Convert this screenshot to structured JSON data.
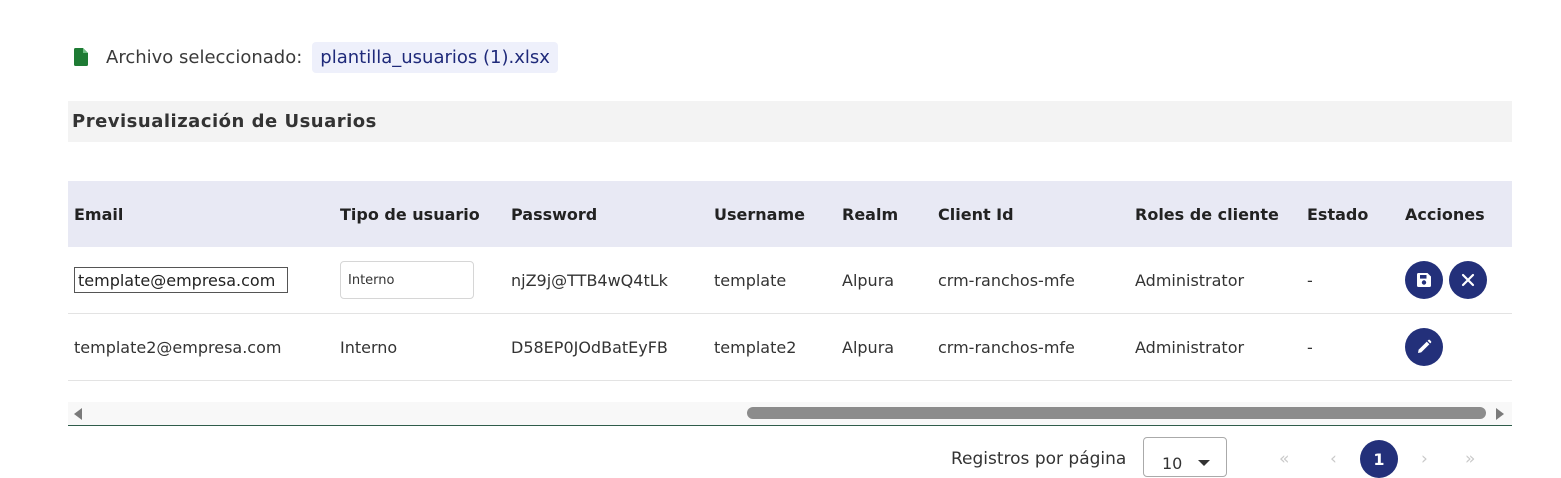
{
  "file": {
    "label": "Archivo seleccionado:",
    "name": "plantilla_usuarios (1).xlsx",
    "icon": "file-icon",
    "icon_color": "#1e7b34"
  },
  "section": {
    "title": "Previsualización de Usuarios"
  },
  "table": {
    "headers": [
      "Email",
      "Tipo de usuario",
      "Password",
      "Username",
      "Realm",
      "Client Id",
      "Roles de cliente",
      "Estado",
      "Acciones"
    ],
    "rows": [
      {
        "email": "template@empresa.com",
        "type": "Interno",
        "password": "njZ9j@TTB4wQ4tLk",
        "username": "template",
        "realm": "Alpura",
        "client_id": "crm-ranchos-mfe",
        "roles": "Administrator",
        "status": "-",
        "editing": true,
        "actions": [
          "save-icon",
          "close-icon"
        ]
      },
      {
        "email": "template2@empresa.com",
        "type": "Interno",
        "password": "D58EP0JOdBatEyFB",
        "username": "template2",
        "realm": "Alpura",
        "client_id": "crm-ranchos-mfe",
        "roles": "Administrator",
        "status": "-",
        "editing": false,
        "actions": [
          "edit-icon"
        ]
      }
    ]
  },
  "pagination": {
    "label": "Registros por página",
    "page_size": "10",
    "current_page": "1",
    "first": "«",
    "prev": "‹",
    "next": "›",
    "last": "»"
  },
  "colors": {
    "accent": "#23307a",
    "header_bg": "#e8e9f4",
    "chip_bg": "#eef0fb"
  }
}
